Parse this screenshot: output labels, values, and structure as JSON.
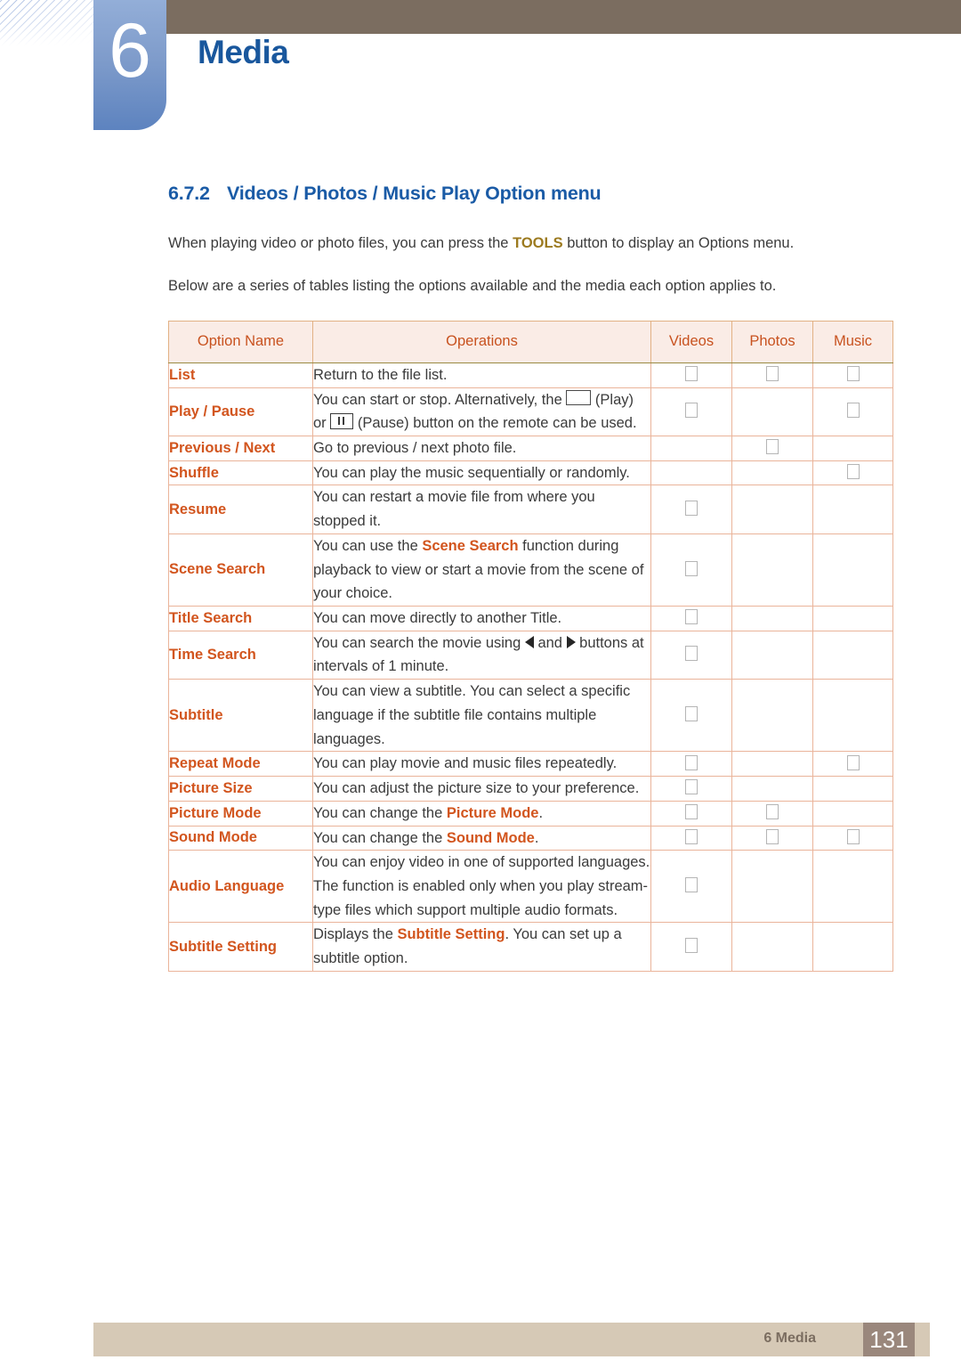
{
  "header": {
    "chapter_number": "6",
    "chapter_title": "Media"
  },
  "section": {
    "number": "6.7.2",
    "title": "Videos / Photos / Music Play Option menu",
    "para1_before": "When playing video or photo files, you can press the ",
    "para1_highlight": "TOOLS",
    "para1_after": " button to display an Options menu.",
    "para2": "Below are a series of tables listing the options available and the media each option applies to."
  },
  "table": {
    "columns": [
      "Option Name",
      "Operations",
      "Videos",
      "Photos",
      "Music"
    ],
    "rows": [
      {
        "name": "List",
        "name_parts": [
          {
            "t": "List",
            "hl": true
          }
        ],
        "ops_parts": [
          {
            "t": "Return to the file list."
          }
        ],
        "videos": true,
        "photos": true,
        "music": true
      },
      {
        "name": "Play / Pause",
        "name_parts": [
          {
            "t": "Play",
            "hl": true
          },
          {
            "t": " / ",
            "hl": false
          },
          {
            "t": "Pause",
            "hl": true
          }
        ],
        "ops_parts": [
          {
            "t": "You can start or stop. Alternatively, the "
          },
          {
            "icon": "play-box-icon"
          },
          {
            "t": " (Play) or "
          },
          {
            "icon": "pause-box-icon"
          },
          {
            "t": " (Pause) button on the remote can be used."
          }
        ],
        "videos": true,
        "photos": false,
        "music": true
      },
      {
        "name": "Previous / Next",
        "name_parts": [
          {
            "t": "Previous",
            "hl": true
          },
          {
            "t": " / ",
            "hl": false
          },
          {
            "t": "Next",
            "hl": true
          }
        ],
        "ops_parts": [
          {
            "t": "Go to previous / next photo file."
          }
        ],
        "videos": false,
        "photos": true,
        "music": false
      },
      {
        "name": "Shuffle",
        "name_parts": [
          {
            "t": "Shuffle",
            "hl": true
          }
        ],
        "ops_parts": [
          {
            "t": "You can play the music sequentially or randomly."
          }
        ],
        "videos": false,
        "photos": false,
        "music": true
      },
      {
        "name": "Resume",
        "name_parts": [
          {
            "t": "Resume",
            "hl": true
          }
        ],
        "ops_parts": [
          {
            "t": "You can restart a movie file from where you stopped it."
          }
        ],
        "videos": true,
        "photos": false,
        "music": false
      },
      {
        "name": "Scene Search",
        "name_parts": [
          {
            "t": "Scene Search",
            "hl": true
          }
        ],
        "ops_parts": [
          {
            "t": "You can use the "
          },
          {
            "t": "Scene Search",
            "hl": true
          },
          {
            "t": " function during playback to view or start a movie from the scene of your choice."
          }
        ],
        "videos": true,
        "photos": false,
        "music": false
      },
      {
        "name": "Title Search",
        "name_parts": [
          {
            "t": "Title Search",
            "hl": true
          }
        ],
        "ops_parts": [
          {
            "t": "You can move directly to another Title."
          }
        ],
        "videos": true,
        "photos": false,
        "music": false
      },
      {
        "name": "Time Search",
        "name_parts": [
          {
            "t": "Time Search",
            "hl": true
          }
        ],
        "ops_parts": [
          {
            "t": "You can search the movie using "
          },
          {
            "icon": "arrow-left-icon"
          },
          {
            "t": " and "
          },
          {
            "icon": "arrow-right-icon"
          },
          {
            "t": " buttons at intervals of 1 minute."
          }
        ],
        "videos": true,
        "photos": false,
        "music": false
      },
      {
        "name": "Subtitle",
        "name_parts": [
          {
            "t": "Subtitle",
            "hl": true
          }
        ],
        "ops_parts": [
          {
            "t": "You can view a subtitle. You can select a specific language if the subtitle file contains multiple languages."
          }
        ],
        "videos": true,
        "photos": false,
        "music": false
      },
      {
        "name": "Repeat Mode",
        "name_parts": [
          {
            "t": "Repeat Mode",
            "hl": true
          }
        ],
        "ops_parts": [
          {
            "t": "You can play movie and music files repeatedly."
          }
        ],
        "videos": true,
        "photos": false,
        "music": true
      },
      {
        "name": "Picture Size",
        "name_parts": [
          {
            "t": "Picture Size",
            "hl": true
          }
        ],
        "ops_parts": [
          {
            "t": "You can adjust the picture size to your preference."
          }
        ],
        "videos": true,
        "photos": false,
        "music": false
      },
      {
        "name": "Picture Mode",
        "name_parts": [
          {
            "t": "Picture Mode",
            "hl": true
          }
        ],
        "ops_parts": [
          {
            "t": "You can change the "
          },
          {
            "t": "Picture Mode",
            "hl": true
          },
          {
            "t": "."
          }
        ],
        "videos": true,
        "photos": true,
        "music": false
      },
      {
        "name": "Sound Mode",
        "name_parts": [
          {
            "t": "Sound Mode",
            "hl": true
          }
        ],
        "ops_parts": [
          {
            "t": "You can change the "
          },
          {
            "t": "Sound Mode",
            "hl": true
          },
          {
            "t": "."
          }
        ],
        "videos": true,
        "photos": true,
        "music": true
      },
      {
        "name": "Audio Language",
        "name_parts": [
          {
            "t": "Audio Language",
            "hl": true
          }
        ],
        "ops_parts": [
          {
            "t": "You can enjoy video in one of supported languages. The function is enabled only when you play stream-type files which support multiple audio formats."
          }
        ],
        "videos": true,
        "photos": false,
        "music": false
      },
      {
        "name": "Subtitle Setting",
        "name_parts": [
          {
            "t": "Subtitle Setting",
            "hl": true
          }
        ],
        "ops_parts": [
          {
            "t": "Displays the "
          },
          {
            "t": "Subtitle Setting",
            "hl": true
          },
          {
            "t": ". You can set up a subtitle option."
          }
        ],
        "videos": true,
        "photos": false,
        "music": false
      }
    ]
  },
  "footer": {
    "label": "6 Media",
    "page": "131"
  },
  "colors": {
    "accent_blue": "#1a5ba6",
    "accent_orange": "#d2551e",
    "header_brown": "#7b6d60",
    "table_header_bg": "#faece6",
    "footer_bg": "#d6c9b6",
    "page_box_bg": "#9a877c",
    "tools_gold": "#9c7a1f"
  }
}
